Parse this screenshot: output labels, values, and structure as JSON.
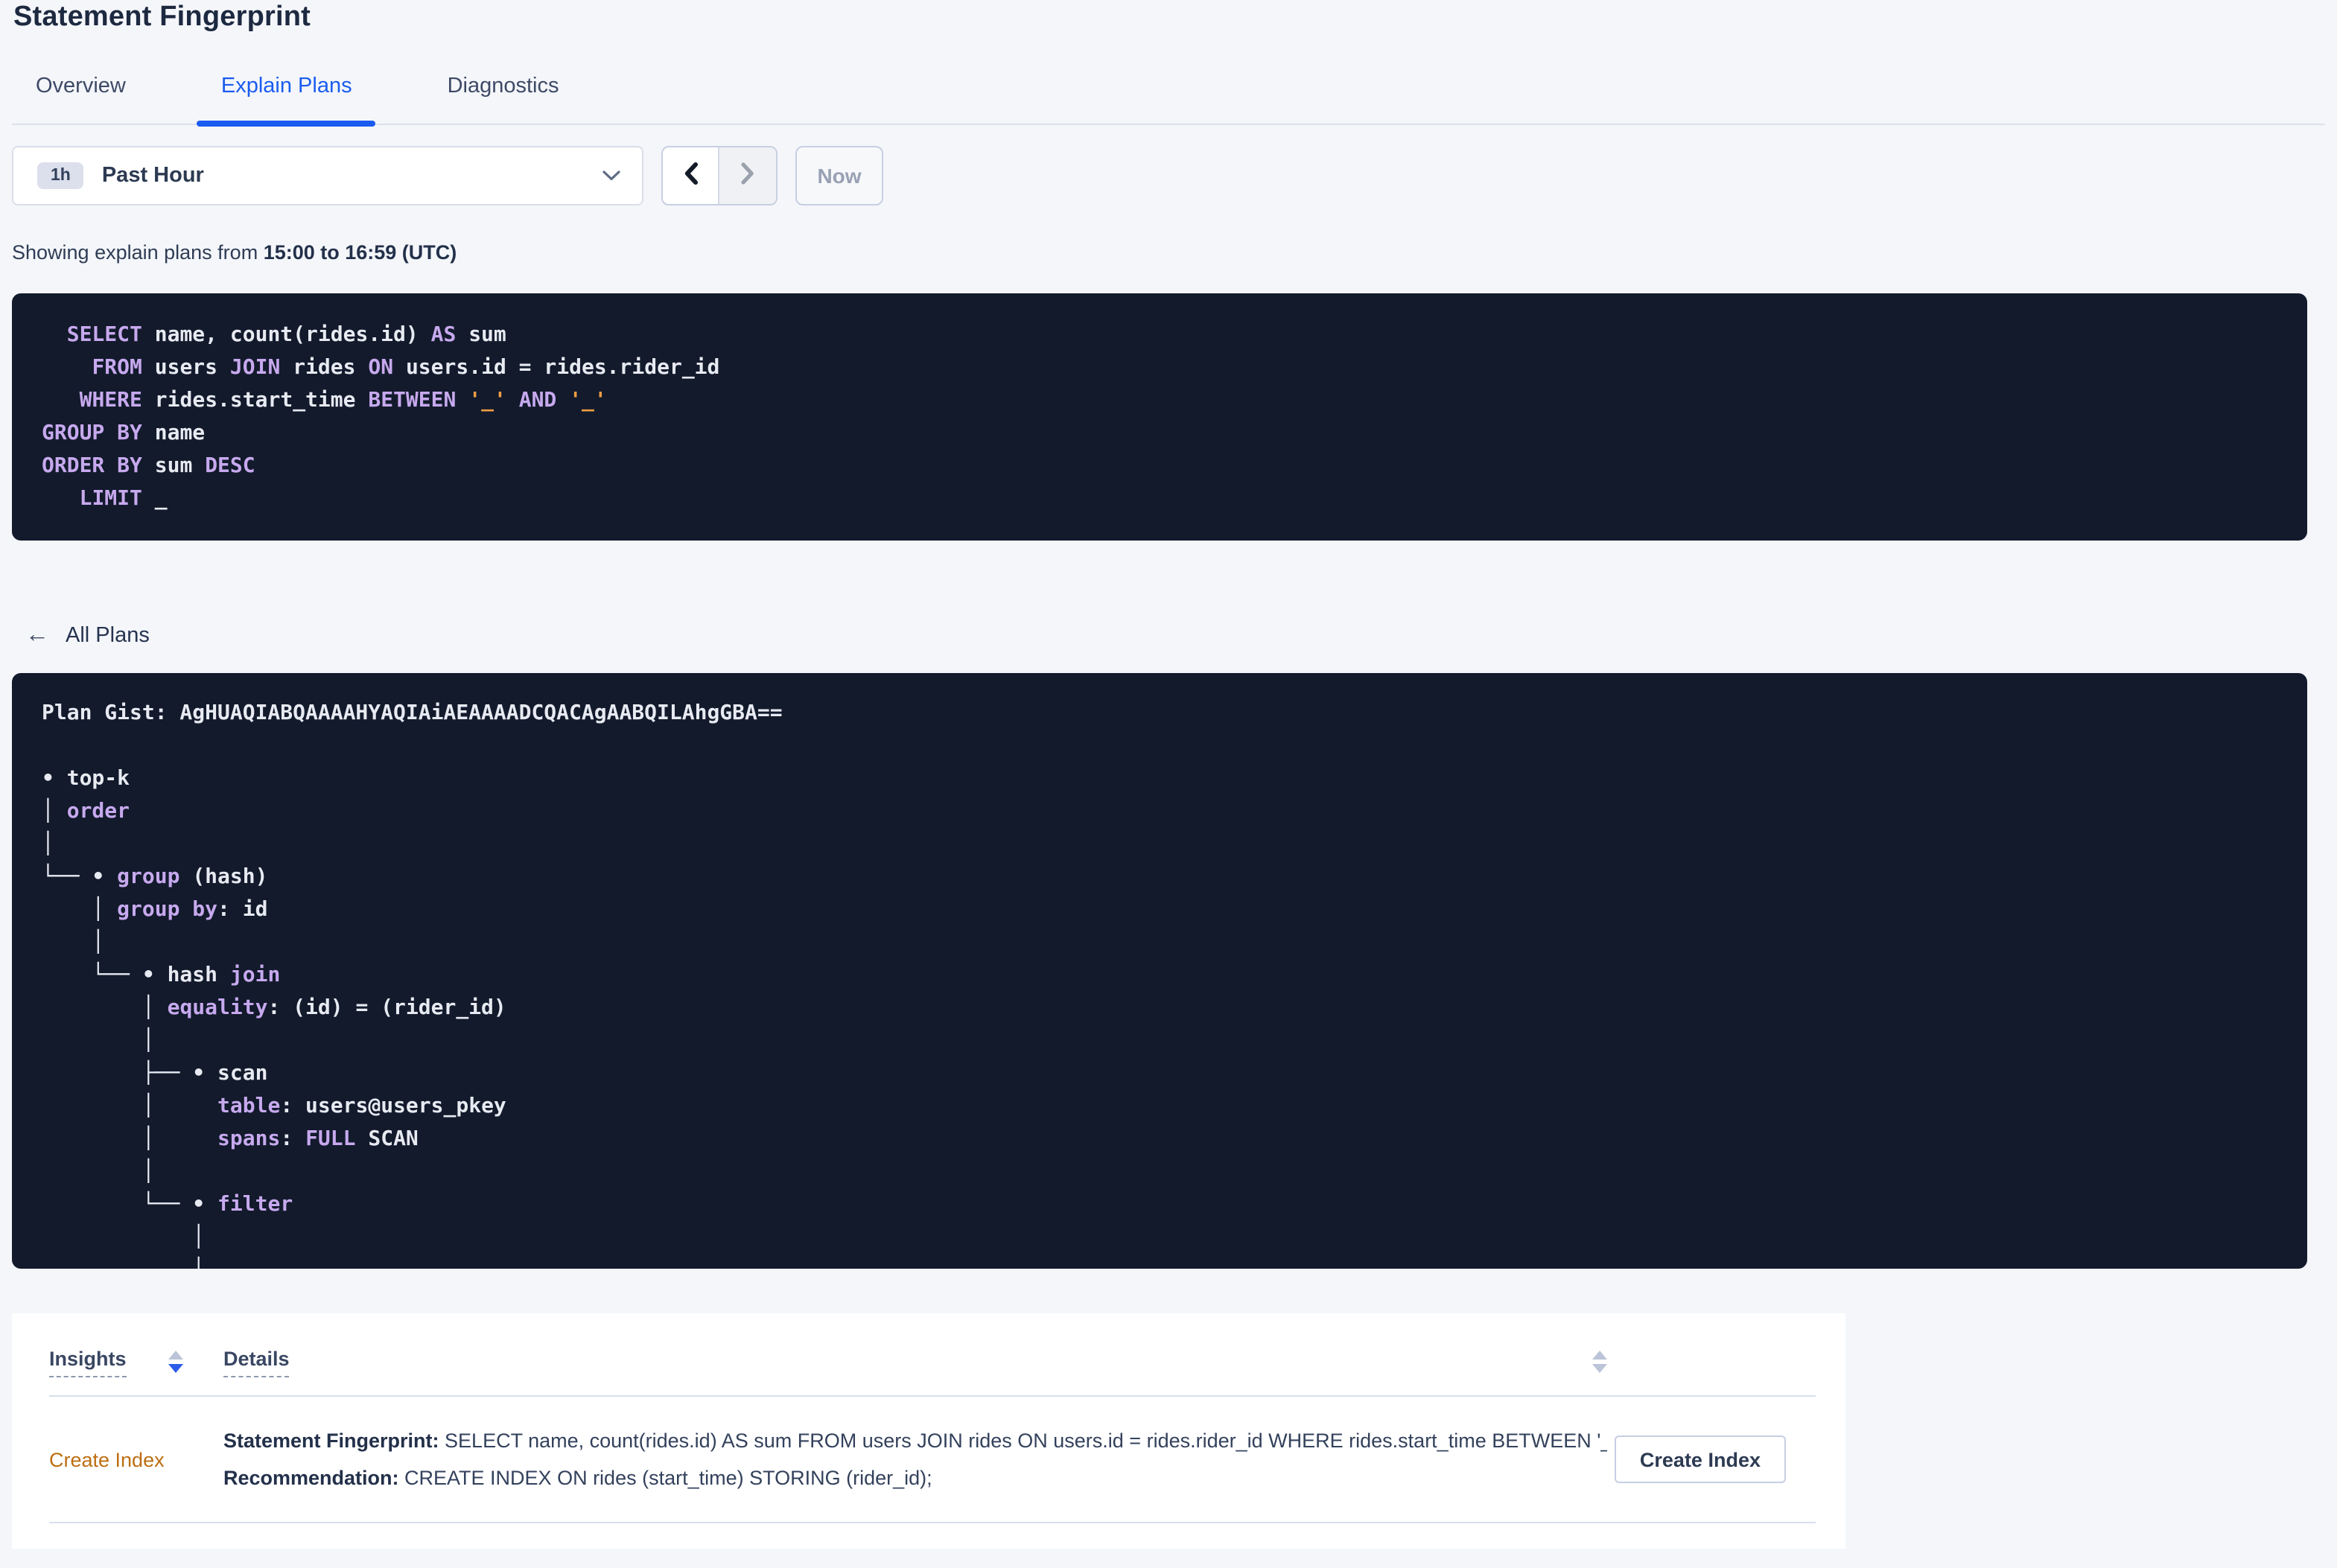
{
  "page": {
    "title": "Statement Fingerprint"
  },
  "tabs": [
    {
      "label": "Overview",
      "active": false
    },
    {
      "label": "Explain Plans",
      "active": true
    },
    {
      "label": "Diagnostics",
      "active": false
    }
  ],
  "toolbar": {
    "time_badge": "1h",
    "time_label": "Past Hour",
    "now_label": "Now"
  },
  "caption": {
    "prefix": "Showing explain plans from ",
    "range": "15:00 to 16:59 (UTC)"
  },
  "sql": {
    "lines": [
      [
        {
          "c": "t",
          "s": "  "
        },
        {
          "c": "k",
          "s": "SELECT"
        },
        {
          "c": "t",
          "s": " name, count(rides.id) "
        },
        {
          "c": "k",
          "s": "AS"
        },
        {
          "c": "t",
          "s": " sum"
        }
      ],
      [
        {
          "c": "t",
          "s": "    "
        },
        {
          "c": "k",
          "s": "FROM"
        },
        {
          "c": "t",
          "s": " users "
        },
        {
          "c": "k",
          "s": "JOIN"
        },
        {
          "c": "t",
          "s": " rides "
        },
        {
          "c": "k",
          "s": "ON"
        },
        {
          "c": "t",
          "s": " users.id = rides.rider_id"
        }
      ],
      [
        {
          "c": "t",
          "s": "   "
        },
        {
          "c": "k",
          "s": "WHERE"
        },
        {
          "c": "t",
          "s": " rides.start_time "
        },
        {
          "c": "k",
          "s": "BETWEEN"
        },
        {
          "c": "t",
          "s": " "
        },
        {
          "c": "l",
          "s": "'_'"
        },
        {
          "c": "t",
          "s": " "
        },
        {
          "c": "k",
          "s": "AND"
        },
        {
          "c": "t",
          "s": " "
        },
        {
          "c": "l",
          "s": "'_'"
        }
      ],
      [
        {
          "c": "k",
          "s": "GROUP BY"
        },
        {
          "c": "t",
          "s": " name"
        }
      ],
      [
        {
          "c": "k",
          "s": "ORDER BY"
        },
        {
          "c": "t",
          "s": " sum "
        },
        {
          "c": "k",
          "s": "DESC"
        }
      ],
      [
        {
          "c": "t",
          "s": "   "
        },
        {
          "c": "k",
          "s": "LIMIT"
        },
        {
          "c": "t",
          "s": " _"
        }
      ]
    ]
  },
  "back_link": {
    "label": "All Plans"
  },
  "plan": {
    "gist": "Plan Gist: AgHUAQIABQAAAAHYAQIAiAEAAAADCQACAgAABQILAhgGBA==",
    "lines": [
      [
        {
          "c": "t",
          "s": "Plan Gist: AgHUAQIABQAAAAHYAQIAiAEAAAADCQACAgAABQILAhgGBA=="
        }
      ],
      [
        {
          "c": "t",
          "s": ""
        }
      ],
      [
        {
          "c": "t",
          "s": "• top-k"
        }
      ],
      [
        {
          "c": "t",
          "s": "│ "
        },
        {
          "c": "k",
          "s": "order"
        }
      ],
      [
        {
          "c": "t",
          "s": "│"
        }
      ],
      [
        {
          "c": "t",
          "s": "└── • "
        },
        {
          "c": "k",
          "s": "group"
        },
        {
          "c": "t",
          "s": " (hash)"
        }
      ],
      [
        {
          "c": "t",
          "s": "    │ "
        },
        {
          "c": "k",
          "s": "group by"
        },
        {
          "c": "t",
          "s": ": id"
        }
      ],
      [
        {
          "c": "t",
          "s": "    │"
        }
      ],
      [
        {
          "c": "t",
          "s": "    └── • hash "
        },
        {
          "c": "k",
          "s": "join"
        }
      ],
      [
        {
          "c": "t",
          "s": "        │ "
        },
        {
          "c": "k",
          "s": "equality"
        },
        {
          "c": "t",
          "s": ": (id) = (rider_id)"
        }
      ],
      [
        {
          "c": "t",
          "s": "        │"
        }
      ],
      [
        {
          "c": "t",
          "s": "        ├── • scan"
        }
      ],
      [
        {
          "c": "t",
          "s": "        │     "
        },
        {
          "c": "k",
          "s": "table"
        },
        {
          "c": "t",
          "s": ": users@users_pkey"
        }
      ],
      [
        {
          "c": "t",
          "s": "        │     "
        },
        {
          "c": "k",
          "s": "spans"
        },
        {
          "c": "t",
          "s": ": "
        },
        {
          "c": "k",
          "s": "FULL"
        },
        {
          "c": "t",
          "s": " SCAN"
        }
      ],
      [
        {
          "c": "t",
          "s": "        │"
        }
      ],
      [
        {
          "c": "t",
          "s": "        └── • "
        },
        {
          "c": "k",
          "s": "filter"
        }
      ],
      [
        {
          "c": "t",
          "s": "            │"
        }
      ],
      [
        {
          "c": "t",
          "s": "            │"
        }
      ]
    ]
  },
  "insights_table": {
    "columns": [
      "Insights",
      "Details"
    ],
    "rows": [
      {
        "insight": "Create Index",
        "details_line1_label": "Statement Fingerprint:",
        "details_line1": " SELECT name, count(rides.id) AS sum FROM users JOIN rides ON users.id = rides.rider_id WHERE rides.start_time BETWEEN '_…",
        "details_line2_label": "Recommendation:",
        "details_line2": " CREATE INDEX ON rides (start_time) STORING (rider_id);",
        "action_label": "Create Index"
      }
    ]
  },
  "colors": {
    "accent-blue": "#1a5cf0",
    "panel-bg": "#121a2c",
    "code-kw": "#c7a9ee",
    "code-text": "#e8eaf2",
    "code-lit": "#f09d43",
    "insight-link": "#bd6e12",
    "sort-active": "#2b5de8",
    "page-bg": "#f4f6fa"
  }
}
